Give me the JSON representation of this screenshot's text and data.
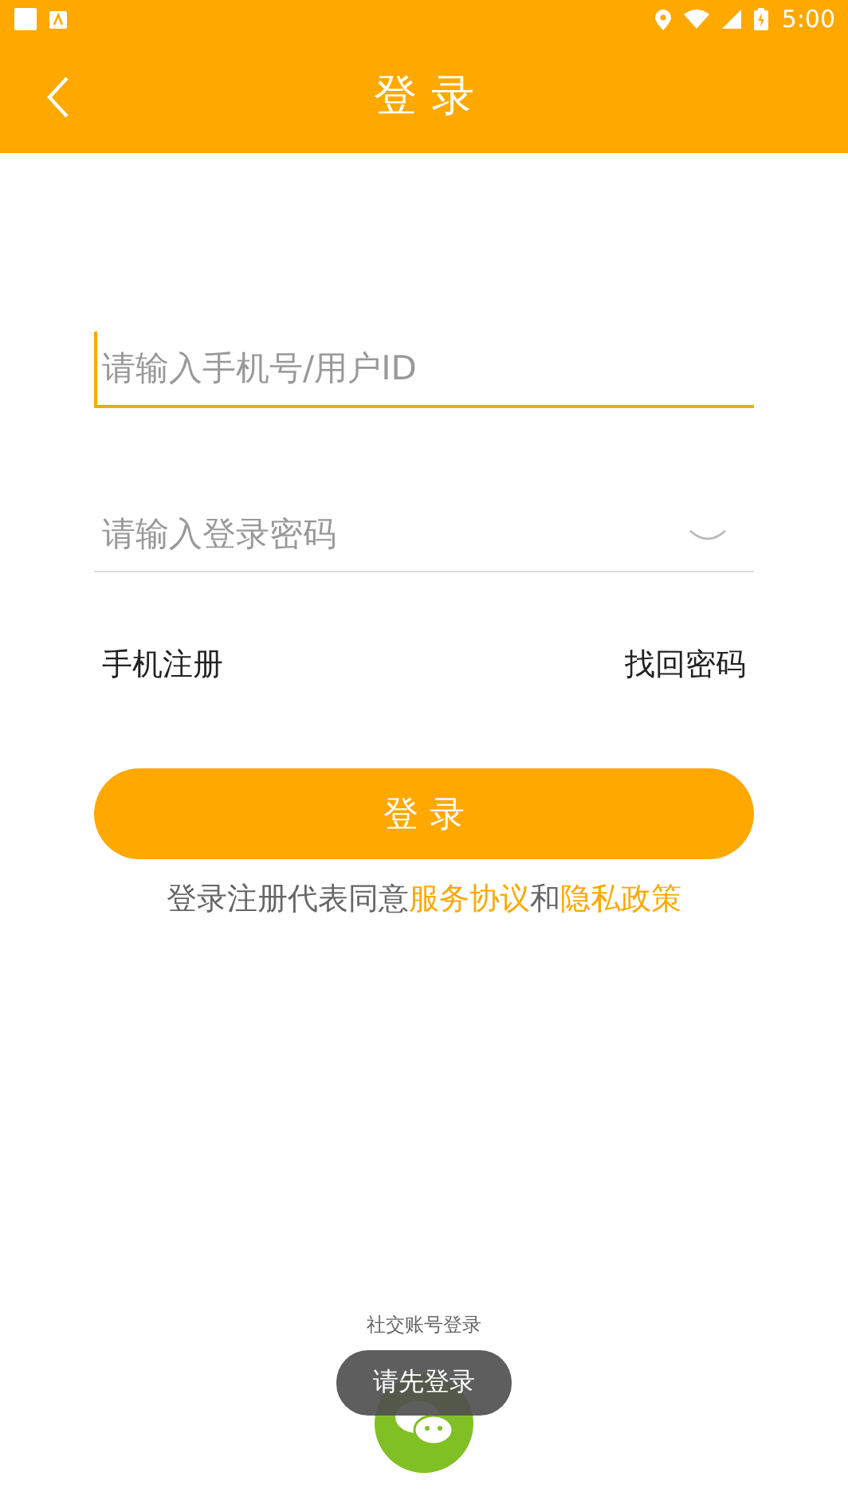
{
  "status_bar": {
    "time": "5:00"
  },
  "header": {
    "title": "登 录"
  },
  "fields": [
    {
      "placeholder": "请输入手机号/用户ID",
      "kind": "text",
      "focused": true
    },
    {
      "placeholder": "请输入登录密码",
      "kind": "password",
      "focused": false
    }
  ],
  "links": {
    "register": "手机注册",
    "recover": "找回密码"
  },
  "login_button": "登 录",
  "agreement": "登录注册代表同意**服务协议**和**隐私政策**",
  "social": {
    "label": "社交账号登录"
  },
  "toast": "请先登录"
}
